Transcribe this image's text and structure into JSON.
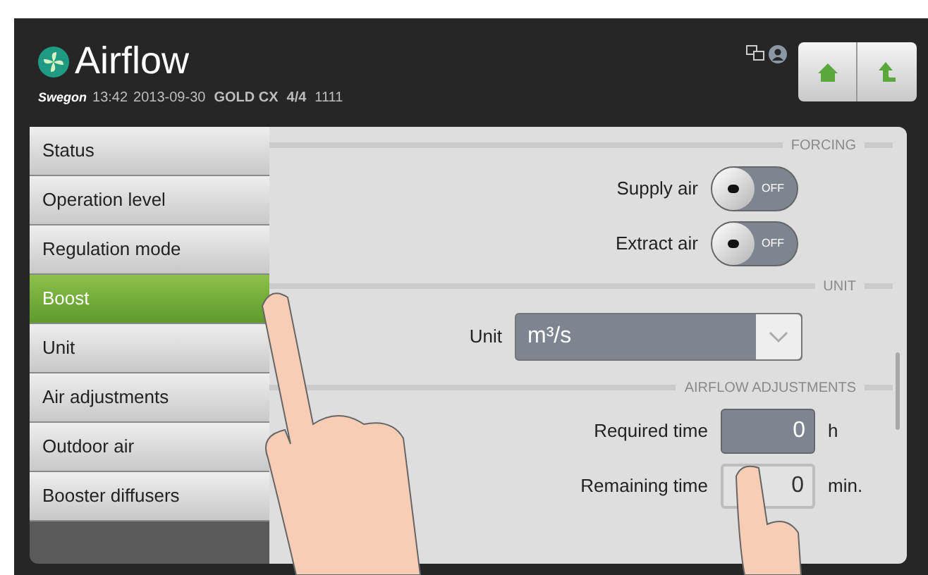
{
  "header": {
    "title": "Airflow",
    "brand": "Swegon",
    "time": "13:42",
    "date": "2013-09-30",
    "model": "GOLD CX",
    "fraction": "4/4",
    "code": "1111"
  },
  "nav": [
    {
      "label": "Status",
      "selected": false
    },
    {
      "label": "Operation level",
      "selected": false
    },
    {
      "label": "Regulation mode",
      "selected": false
    },
    {
      "label": "Boost",
      "selected": true
    },
    {
      "label": "Unit",
      "selected": false
    },
    {
      "label": "Air adjustments",
      "selected": false
    },
    {
      "label": "Outdoor air",
      "selected": false
    },
    {
      "label": "Booster diffusers",
      "selected": false
    }
  ],
  "sections": [
    {
      "title": "FORCING",
      "rows": [
        {
          "kind": "toggle",
          "label": "Supply air",
          "on": false,
          "state_text": "OFF"
        },
        {
          "kind": "toggle",
          "label": "Extract air",
          "on": false,
          "state_text": "OFF"
        }
      ]
    },
    {
      "title": "UNIT",
      "rows": [
        {
          "kind": "select",
          "label": "Unit",
          "value": "m³/s"
        }
      ]
    },
    {
      "title": "AIRFLOW ADJUSTMENTS",
      "rows": [
        {
          "kind": "number",
          "label": "Required time",
          "value": "0",
          "unit": "h",
          "focused": true
        },
        {
          "kind": "number",
          "label": "Remaining time",
          "value": "0",
          "unit": "min.",
          "focused": false
        }
      ]
    }
  ]
}
